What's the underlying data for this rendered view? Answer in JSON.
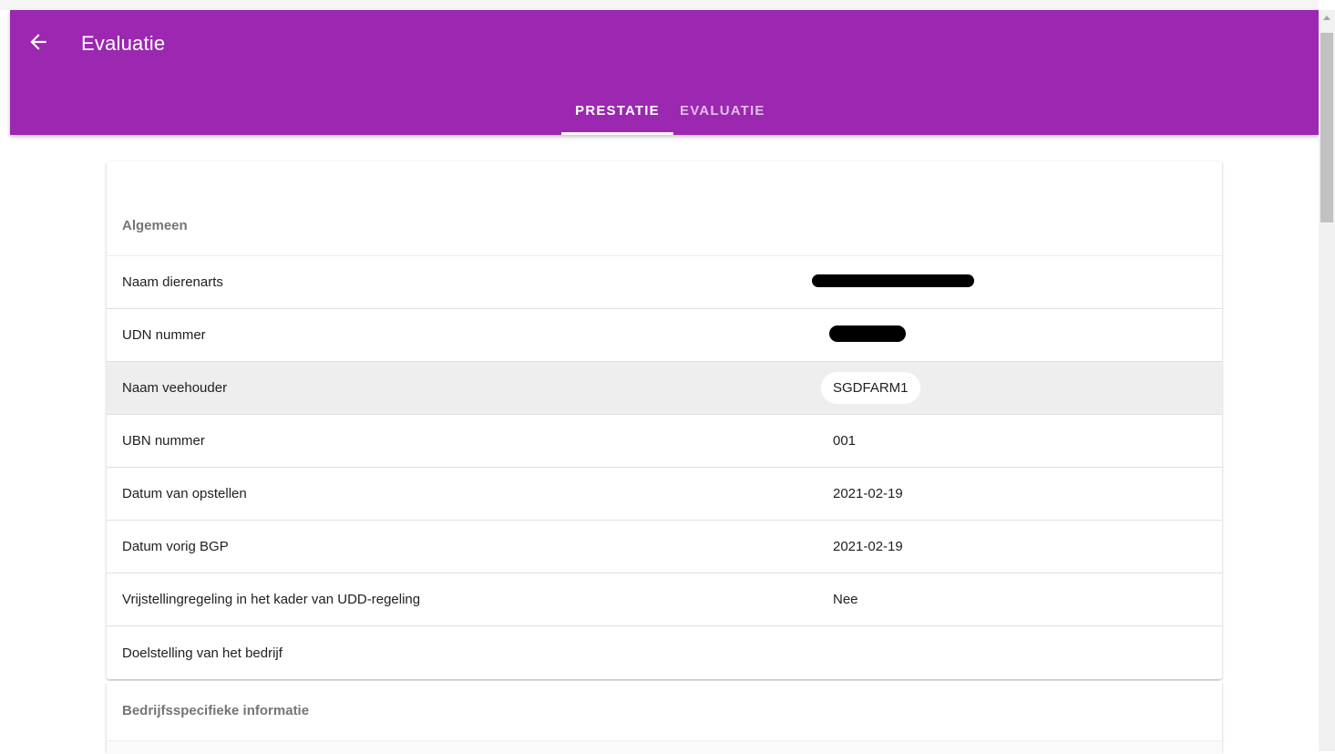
{
  "appbar": {
    "title": "Evaluatie",
    "back_icon": "arrow-back-icon",
    "color": "#9c27b0"
  },
  "tabs": [
    {
      "label": "PRESTATIE",
      "active": true
    },
    {
      "label": "EVALUATIE",
      "active": false
    }
  ],
  "general": {
    "header": "Algemeen",
    "rows": [
      {
        "label": "Naam dierenarts",
        "value": "",
        "redacted": true
      },
      {
        "label": "UDN nummer",
        "value": "",
        "redacted": true
      },
      {
        "label": "Naam veehouder",
        "value": "SGDFARM1",
        "highlighted": true
      },
      {
        "label": "UBN nummer",
        "value": "001"
      },
      {
        "label": "Datum van opstellen",
        "value": "2021-02-19"
      },
      {
        "label": "Datum vorig BGP",
        "value": "2021-02-19"
      },
      {
        "label": "Vrijstellingregeling in het kader van UDD-regeling",
        "value": "Nee"
      },
      {
        "label": "Doelstelling van het bedrijf",
        "value": ""
      }
    ]
  },
  "company_specific": {
    "header": "Bedrijfsspecifieke informatie"
  }
}
